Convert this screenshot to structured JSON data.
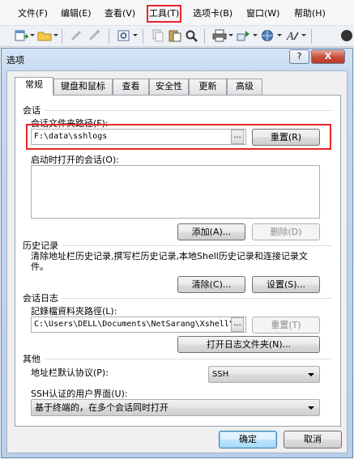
{
  "menubar": {
    "items": [
      {
        "label": "文件(F)"
      },
      {
        "label": "编辑(E)"
      },
      {
        "label": "查看(V)"
      },
      {
        "label": "工具(T)"
      },
      {
        "label": "选项卡(B)"
      },
      {
        "label": "窗口(W)"
      },
      {
        "label": "帮助(H)"
      }
    ]
  },
  "dialog": {
    "title": "选项",
    "help_label": "?",
    "close_label": "X",
    "tabs": [
      {
        "label": "常规",
        "active": true
      },
      {
        "label": "键盘和鼠标"
      },
      {
        "label": "查看"
      },
      {
        "label": "安全性"
      },
      {
        "label": "更新"
      },
      {
        "label": "高级"
      }
    ],
    "session": {
      "section_title": "会话",
      "folder_label": "会话文件夹路径(F):",
      "folder_value": "F:\\data\\sshlogs",
      "browse_label": "...",
      "reset_label": "重置(R)",
      "startup_label": "启动时打开的会话(O):",
      "add_label": "添加(A)...",
      "delete_label": "删除(D)"
    },
    "history": {
      "section_title": "历史记录",
      "description": "清除地址栏历史记录,撰写栏历史记录,本地Shell历史记录和连接记录文件。",
      "clear_label": "清除(C)...",
      "settings_label": "设置(S)..."
    },
    "session_log": {
      "section_title": "会话日志",
      "folder_label": "記錄檔資料夾路徑(L):",
      "folder_value": "C:\\Users\\DELL\\Documents\\NetSarang\\Xshell\\",
      "browse_label": "...",
      "reset_label": "重置(T)",
      "open_label": "打开日志文件夹(N)..."
    },
    "other": {
      "section_title": "其他",
      "protocol_label": "地址栏默认协议(P):",
      "protocol_value": "SSH",
      "ui_label": "SSH认证的用户界面(U):",
      "ui_value": "基于终端的，在多个会话同时打开"
    },
    "ok_label": "确定",
    "cancel_label": "取消"
  },
  "colors": {
    "highlight_red": "#e8262a",
    "dialog_frame": "#b9cfea"
  }
}
